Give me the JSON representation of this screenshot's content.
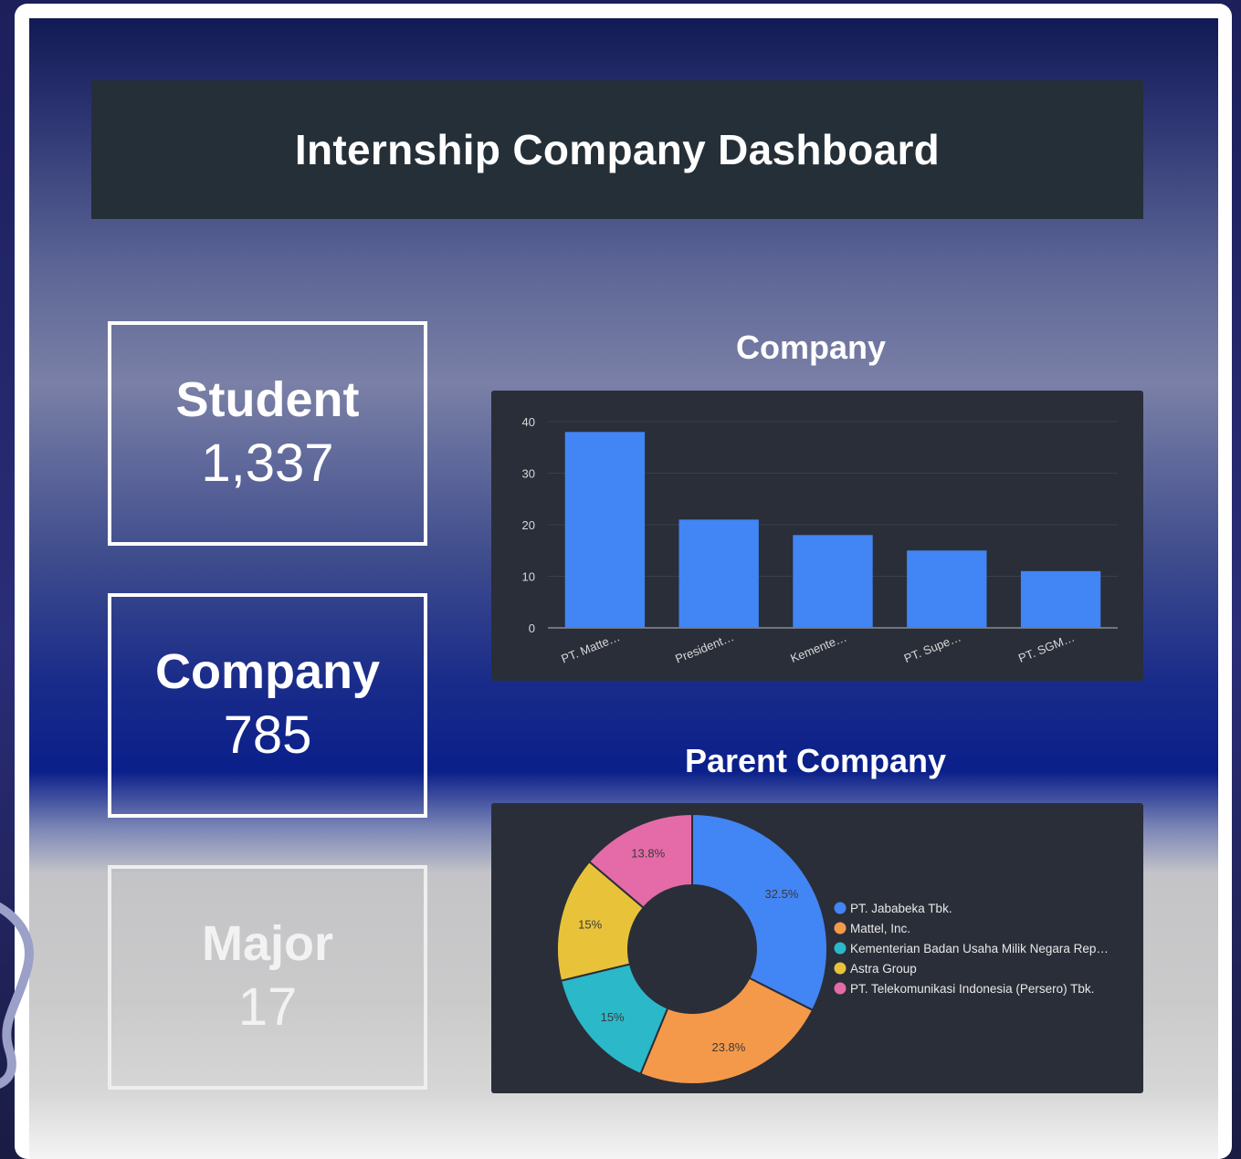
{
  "header": {
    "title": "Internship Company Dashboard"
  },
  "kpis": [
    {
      "label": "Student",
      "value": "1,337"
    },
    {
      "label": "Company",
      "value": "785"
    },
    {
      "label": "Major",
      "value": "17"
    }
  ],
  "company_chart_title": "Company",
  "parent_chart_title": "Parent Company",
  "colors": {
    "bar": "#4285f4",
    "panel": "#2a2e38",
    "title_bar": "#252f37"
  },
  "chart_data": [
    {
      "type": "bar",
      "title": "Company",
      "categories": [
        "PT. Matte…",
        "President…",
        "Kemente…",
        "PT. Supe…",
        "PT. SGM…"
      ],
      "values": [
        38,
        21,
        18,
        15,
        11
      ],
      "ylim": [
        0,
        40
      ],
      "yticks": [
        0,
        10,
        20,
        30,
        40
      ],
      "grid": true
    },
    {
      "type": "pie",
      "title": "Parent Company",
      "donut": true,
      "legend_position": "right",
      "labels": [
        "PT. Jababeka Tbk.",
        "Mattel, Inc.",
        "Kementerian Badan Usaha Milik Negara Rep…",
        "Astra Group",
        "PT. Telekomunikasi Indonesia (Persero) Tbk."
      ],
      "values": [
        32.5,
        23.8,
        15,
        15,
        13.8
      ],
      "value_labels": [
        "32.5%",
        "23.8%",
        "15%",
        "15%",
        "13.8%"
      ],
      "colors": [
        "#4285f4",
        "#f4994a",
        "#2bb8c9",
        "#e8c33a",
        "#e46ba8"
      ]
    }
  ]
}
